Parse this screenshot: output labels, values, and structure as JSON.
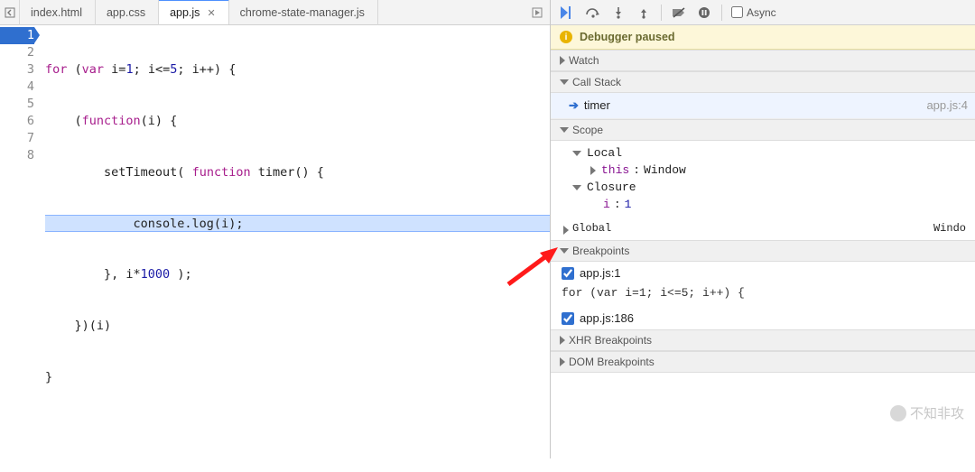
{
  "tabs": [
    "index.html",
    "app.css",
    "app.js",
    "chrome-state-manager.js"
  ],
  "active_tab_index": 2,
  "code": {
    "lines": [
      "for (var i=1; i<=5; i++) {",
      "    (function(i) {",
      "        setTimeout( function timer() {",
      "            console.log(i);",
      "        }, i*1000 );",
      "    })(i)",
      "}",
      ""
    ],
    "exec_line": 1,
    "highlight_line": 4
  },
  "toolbar": {
    "async_label": "Async",
    "async_checked": false
  },
  "paused_message": "Debugger paused",
  "sections": {
    "watch": "Watch",
    "callstack": "Call Stack",
    "scope": "Scope",
    "breakpoints": "Breakpoints",
    "xhr_breakpoints": "XHR Breakpoints",
    "dom_breakpoints": "DOM Breakpoints"
  },
  "callstack": {
    "frame_name": "timer",
    "frame_loc": "app.js:4"
  },
  "scope": {
    "local_label": "Local",
    "local_this_key": "this",
    "local_this_val": "Window",
    "closure_label": "Closure",
    "closure_key": "i",
    "closure_val": "1",
    "global_label": "Global",
    "global_val": "Windo"
  },
  "breakpoints": {
    "items": [
      {
        "label": "app.js:1",
        "checked": true,
        "code": "for (var i=1; i<=5; i++) {"
      },
      {
        "label": "app.js:186",
        "checked": true
      }
    ]
  },
  "watermark": "不知非攻"
}
